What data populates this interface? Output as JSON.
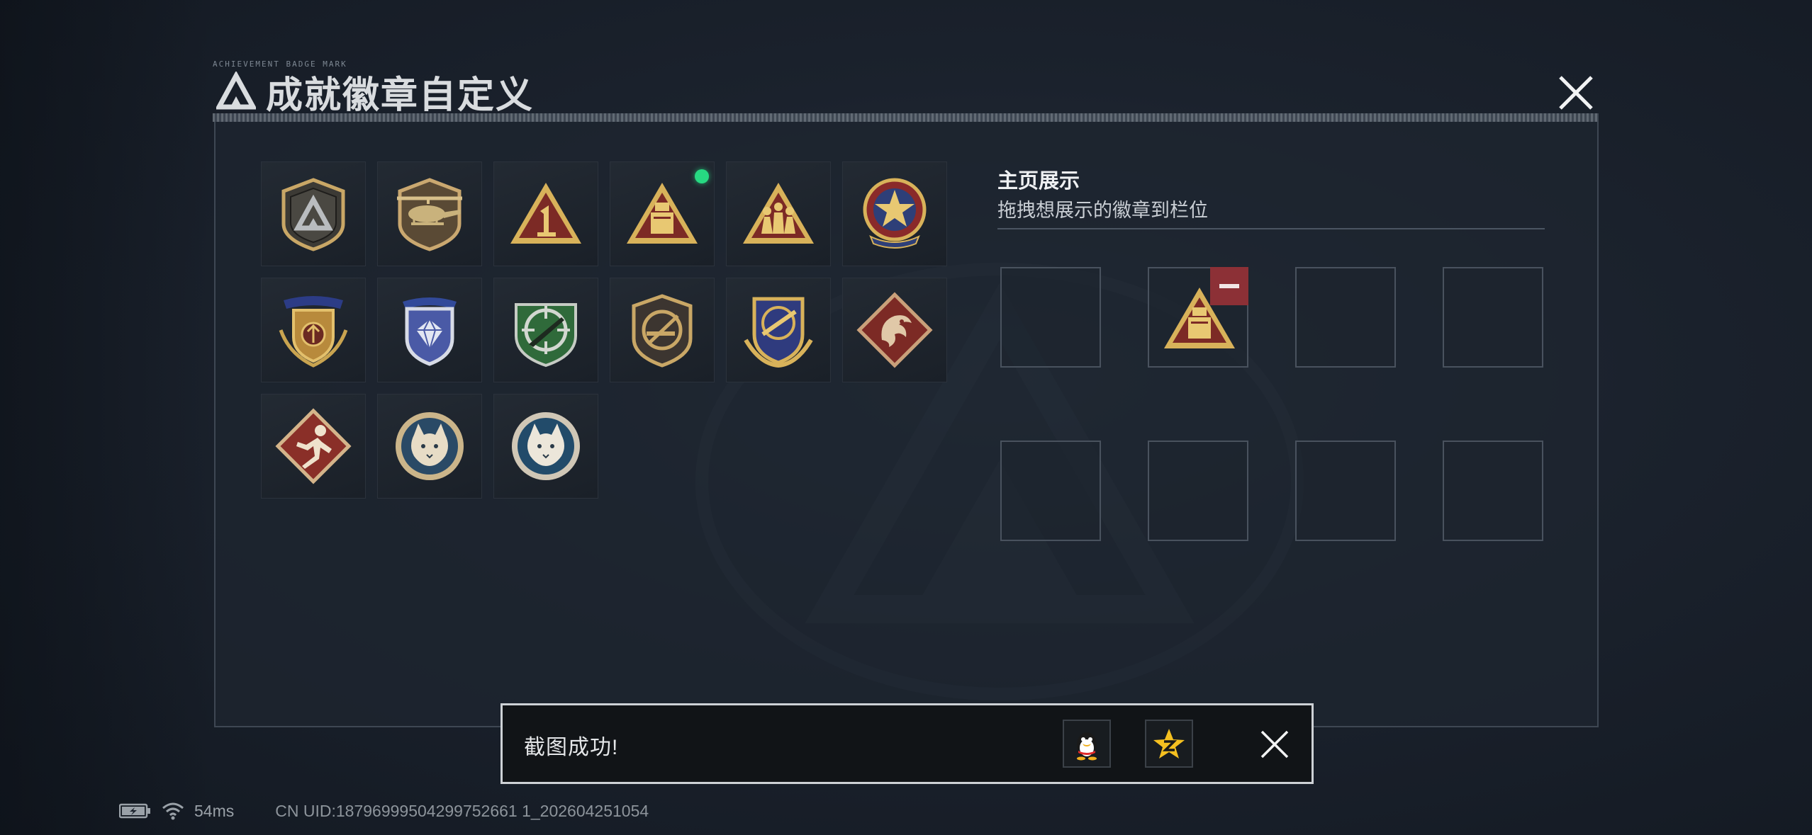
{
  "header": {
    "code_text": "ACHIEVEMENT BADGE MARK",
    "title": "成就徽章自定义"
  },
  "badges": [
    {
      "name": "delta-shield-badge",
      "equipped": false
    },
    {
      "name": "helicopter-badge",
      "equipped": false
    },
    {
      "name": "number-one-triangle-badge",
      "equipped": false
    },
    {
      "name": "card-triangle-badge",
      "equipped": true
    },
    {
      "name": "squad-triangle-badge",
      "equipped": false
    },
    {
      "name": "star-medal-badge",
      "equipped": false
    },
    {
      "name": "gold-wings-crest-badge",
      "equipped": false
    },
    {
      "name": "blue-gem-shield-badge",
      "equipped": false
    },
    {
      "name": "green-rifle-crosshair-badge",
      "equipped": false
    },
    {
      "name": "gold-rifle-shield-badge",
      "equipped": false
    },
    {
      "name": "blue-rifle-crest-badge",
      "equipped": false
    },
    {
      "name": "dragon-diamond-badge",
      "equipped": false
    },
    {
      "name": "sprinter-diamond-badge",
      "equipped": false
    },
    {
      "name": "lynx-round-badge-1",
      "equipped": false
    },
    {
      "name": "lynx-round-badge-2",
      "equipped": false
    }
  ],
  "showcase": {
    "title": "主页展示",
    "subtitle": "拖拽想展示的徽章到栏位",
    "slots": [
      "",
      "card-triangle-badge",
      "",
      "",
      "",
      "",
      "",
      ""
    ]
  },
  "toast": {
    "message": "截图成功!"
  },
  "statusbar": {
    "ping": "54ms",
    "uid": "CN UID:18796999504299752661 1_202604251054"
  },
  "colors": {
    "equipped_dot": "#27d982",
    "remove_button": "#8c3036",
    "gold": "#d8b25a",
    "maroon": "#7c2a25"
  }
}
